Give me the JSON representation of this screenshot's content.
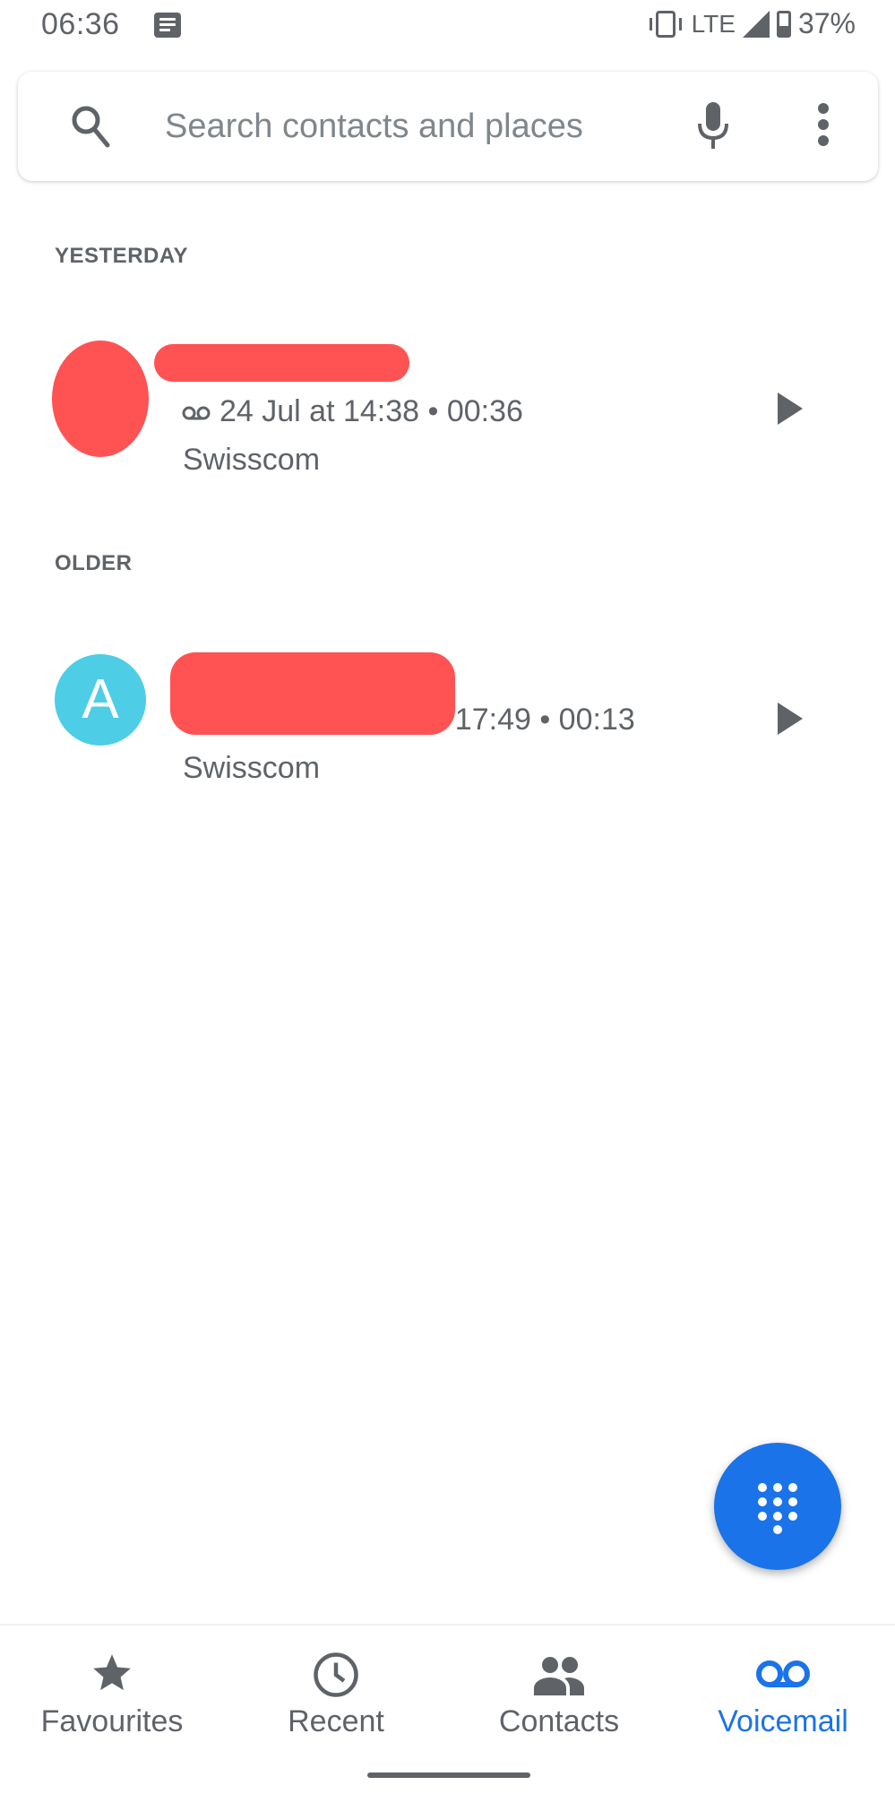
{
  "status_bar": {
    "time": "06:36",
    "notification_icon": "message-icon",
    "vibrate_icon": "vibrate-icon",
    "network": "LTE",
    "signal_icon": "signal-icon",
    "battery_icon": "battery-icon",
    "battery": "37%"
  },
  "search": {
    "placeholder": "Search contacts and places",
    "search_icon": "search-icon",
    "mic_icon": "mic-icon",
    "more_icon": "more-vert-icon"
  },
  "sections": [
    {
      "header": "YESTERDAY",
      "items": [
        {
          "name": "[redacted]",
          "avatar": "[redacted]",
          "meta": "24 Jul at 14:38 • 00:36",
          "carrier": "Swisscom",
          "action_icon": "play-icon"
        }
      ]
    },
    {
      "header": "OLDER",
      "items": [
        {
          "name": "[redacted]",
          "avatar": "A",
          "avatar_color": "#4ecde6",
          "meta": "at 17:49 • 00:13",
          "carrier": "Swisscom",
          "action_icon": "play-icon"
        }
      ]
    }
  ],
  "fab": {
    "icon": "dialpad-icon",
    "color": "#1a73e8"
  },
  "bottom_nav": {
    "active": "Voicemail",
    "active_color": "#1a73e8",
    "items": [
      {
        "label": "Favourites",
        "icon": "star-icon"
      },
      {
        "label": "Recent",
        "icon": "clock-icon"
      },
      {
        "label": "Contacts",
        "icon": "people-icon"
      },
      {
        "label": "Voicemail",
        "icon": "voicemail-icon"
      }
    ]
  },
  "redaction_color": "#ff5252"
}
